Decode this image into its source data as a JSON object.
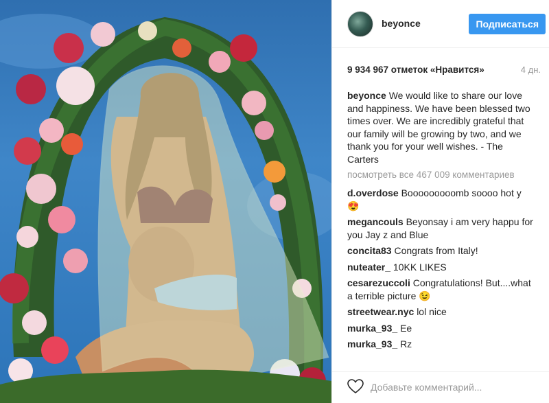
{
  "post": {
    "username": "beyonce",
    "follow_label": "Подписаться",
    "likes": "9 934 967 отметок «Нравится»",
    "time_ago": "4 дн.",
    "caption_user": "beyonce",
    "caption_text": "We would like to share our love and happiness. We have been blessed two times over. We are incredibly grateful that our family will be growing by two, and we thank you for your well wishes. - The Carters",
    "view_all": "посмотреть все 467 009 комментариев",
    "comments": [
      {
        "user": "d.overdose",
        "text": "Booooooooomb soooo hot y 😍"
      },
      {
        "user": "megancouls",
        "text": "Beyonsay i am very happu for you Jay z and Blue"
      },
      {
        "user": "concita83",
        "text": "Congrats from Italy!"
      },
      {
        "user": "nuteater_",
        "text": "10KK LIKES"
      },
      {
        "user": "cesarezuccoli",
        "text": "Congratulations! But....what a terrible picture 😉"
      },
      {
        "user": "streetwear.nyc",
        "text": "lol nice"
      },
      {
        "user": "murka_93_",
        "text": "Ee"
      },
      {
        "user": "murka_93_",
        "text": "Rz"
      }
    ],
    "add_comment_placeholder": "Добавьте комментарий..."
  },
  "icons": {
    "like": "heart-outline-icon"
  },
  "colors": {
    "accent": "#3897f0",
    "muted": "#999999",
    "text": "#262626"
  }
}
